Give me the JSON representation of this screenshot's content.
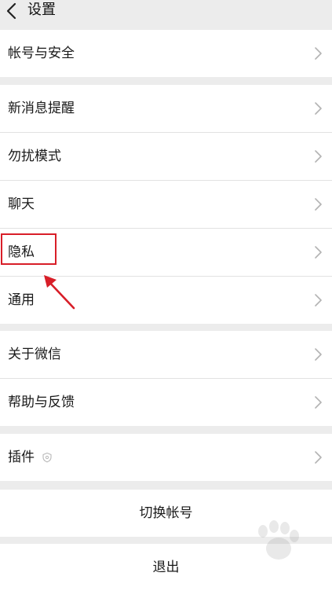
{
  "header": {
    "title": "设置"
  },
  "sections": [
    {
      "items": [
        {
          "label": "帐号与安全"
        }
      ]
    },
    {
      "items": [
        {
          "label": "新消息提醒"
        },
        {
          "label": "勿扰模式"
        },
        {
          "label": "聊天"
        },
        {
          "label": "隐私"
        },
        {
          "label": "通用"
        }
      ]
    },
    {
      "items": [
        {
          "label": "关于微信"
        },
        {
          "label": "帮助与反馈"
        }
      ]
    },
    {
      "items": [
        {
          "label": "插件"
        }
      ]
    }
  ],
  "actions": {
    "switch_account": "切换帐号",
    "logout": "退出"
  },
  "annotation": {
    "highlight_color": "#d81e28"
  }
}
